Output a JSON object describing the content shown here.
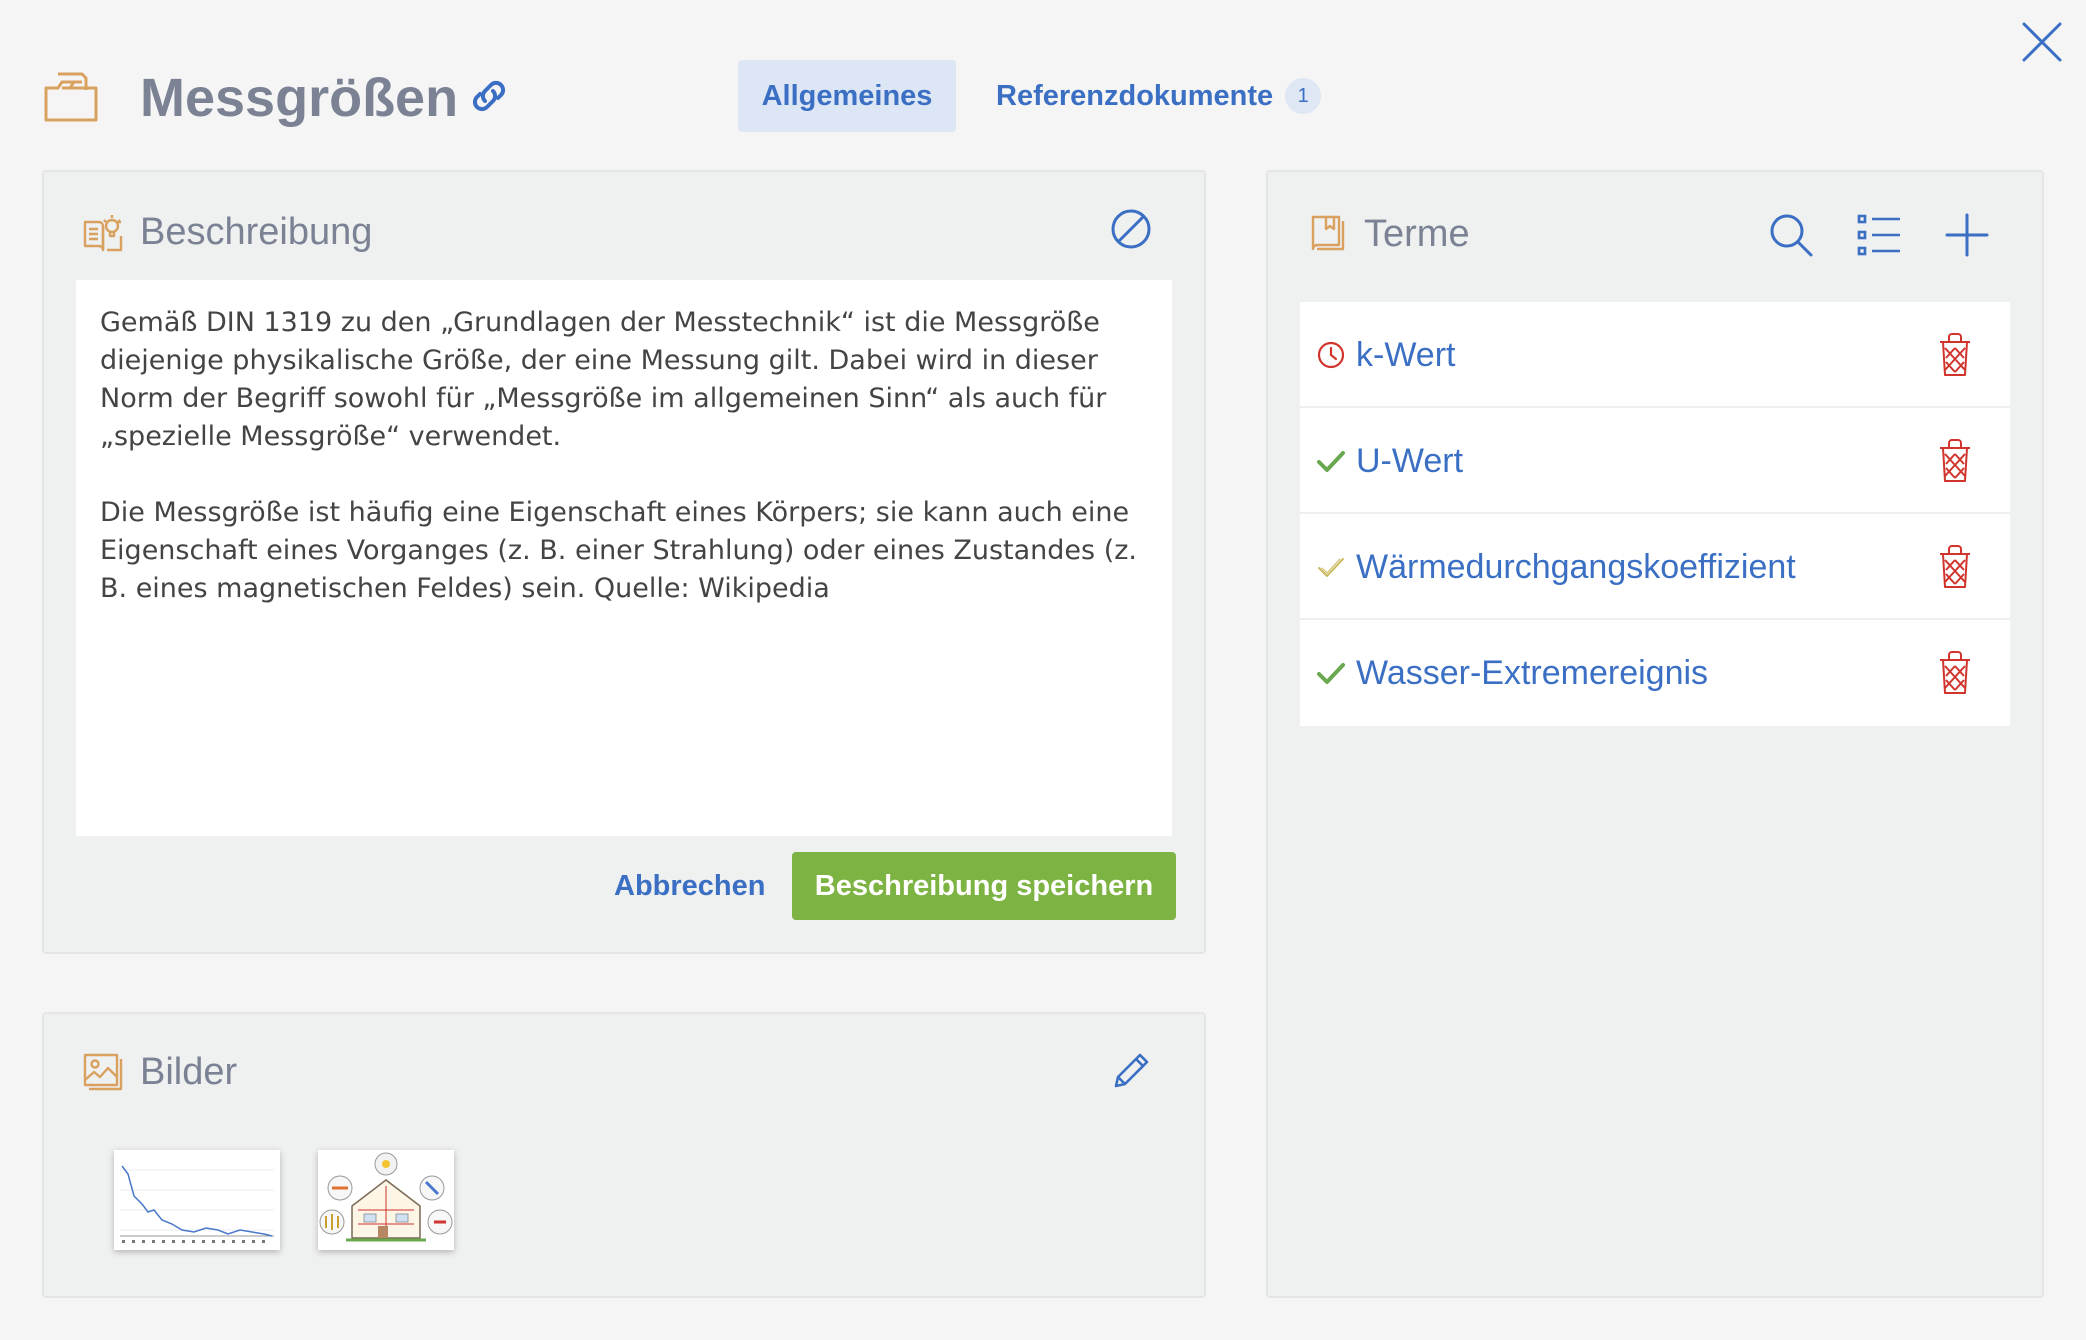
{
  "header": {
    "title": "Messgrößen",
    "icons": {
      "folder": "folder-icon",
      "link": "link-icon",
      "close": "close-icon"
    }
  },
  "tabs": [
    {
      "label": "Allgemeines",
      "active": true
    },
    {
      "label": "Referenzdokumente",
      "badge": "1",
      "active": false
    }
  ],
  "description": {
    "title": "Beschreibung",
    "paragraphs": [
      "Gemäß DIN 1319 zu den „Grundlagen der Messtechnik“ ist die Messgröße diejenige physikalische Größe, der eine Messung gilt. Dabei wird in dieser Norm der Begriff sowohl für „Messgröße im allgemeinen Sinn“ als auch für „spezielle Messgröße“ verwendet.",
      "Die Messgröße ist häufig eine Eigenschaft eines Körpers; sie kann auch eine Eigenschaft eines Vorganges (z. B. einer Strahlung) oder eines Zustandes (z. B. eines magnetischen Feldes) sein. Quelle: Wikipedia"
    ],
    "cancel_label": "Abbrechen",
    "save_label": "Beschreibung speichern"
  },
  "images": {
    "title": "Bilder",
    "thumbnails": [
      "line-chart-thumbnail",
      "house-diagram-thumbnail"
    ]
  },
  "terms": {
    "title": "Terme",
    "items": [
      {
        "label": "k-Wert",
        "status": "pending"
      },
      {
        "label": "U-Wert",
        "status": "approved"
      },
      {
        "label": "Wärmedurchgangskoeffizient",
        "status": "approved-light"
      },
      {
        "label": "Wasser-Extremereignis",
        "status": "approved"
      }
    ]
  },
  "colors": {
    "accent": "#3a6fc4",
    "title_gray": "#7b8294",
    "save_green": "#7cb342",
    "delete_red": "#d0342c",
    "icon_orange": "#d9a15f",
    "check_green": "#6aa84f",
    "check_light": "#c9b85a"
  }
}
